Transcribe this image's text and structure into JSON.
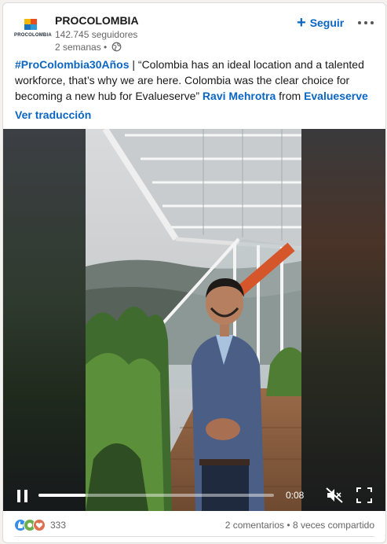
{
  "author": {
    "name": "PROCOLOMBIA",
    "logo_text": "PROCOLOMBIA",
    "followers": "142.745 seguidores",
    "time": "2 semanas •"
  },
  "actions": {
    "follow_label": "Seguir"
  },
  "post": {
    "hashtag": "#ProColombia30Años",
    "text_main": " | “Colombia has an ideal location and a talented workforce, that’s why we are here. Colombia was the clear choice for becoming a new hub for Evalueserve” ",
    "mention_person": "Ravi Mehrotra",
    "from_word": " from ",
    "mention_company": "Evalueserve",
    "see_translation": "Ver traducción"
  },
  "video": {
    "time": "0:08",
    "progress": 0.2
  },
  "social": {
    "reaction_count": "333",
    "comments": "2 comentarios",
    "separator": " • ",
    "shares": "8 veces compartido"
  },
  "colors": {
    "accent": "#0a66c2",
    "like": "#378fe9",
    "celebrate": "#6dae4f",
    "love": "#df704d"
  }
}
